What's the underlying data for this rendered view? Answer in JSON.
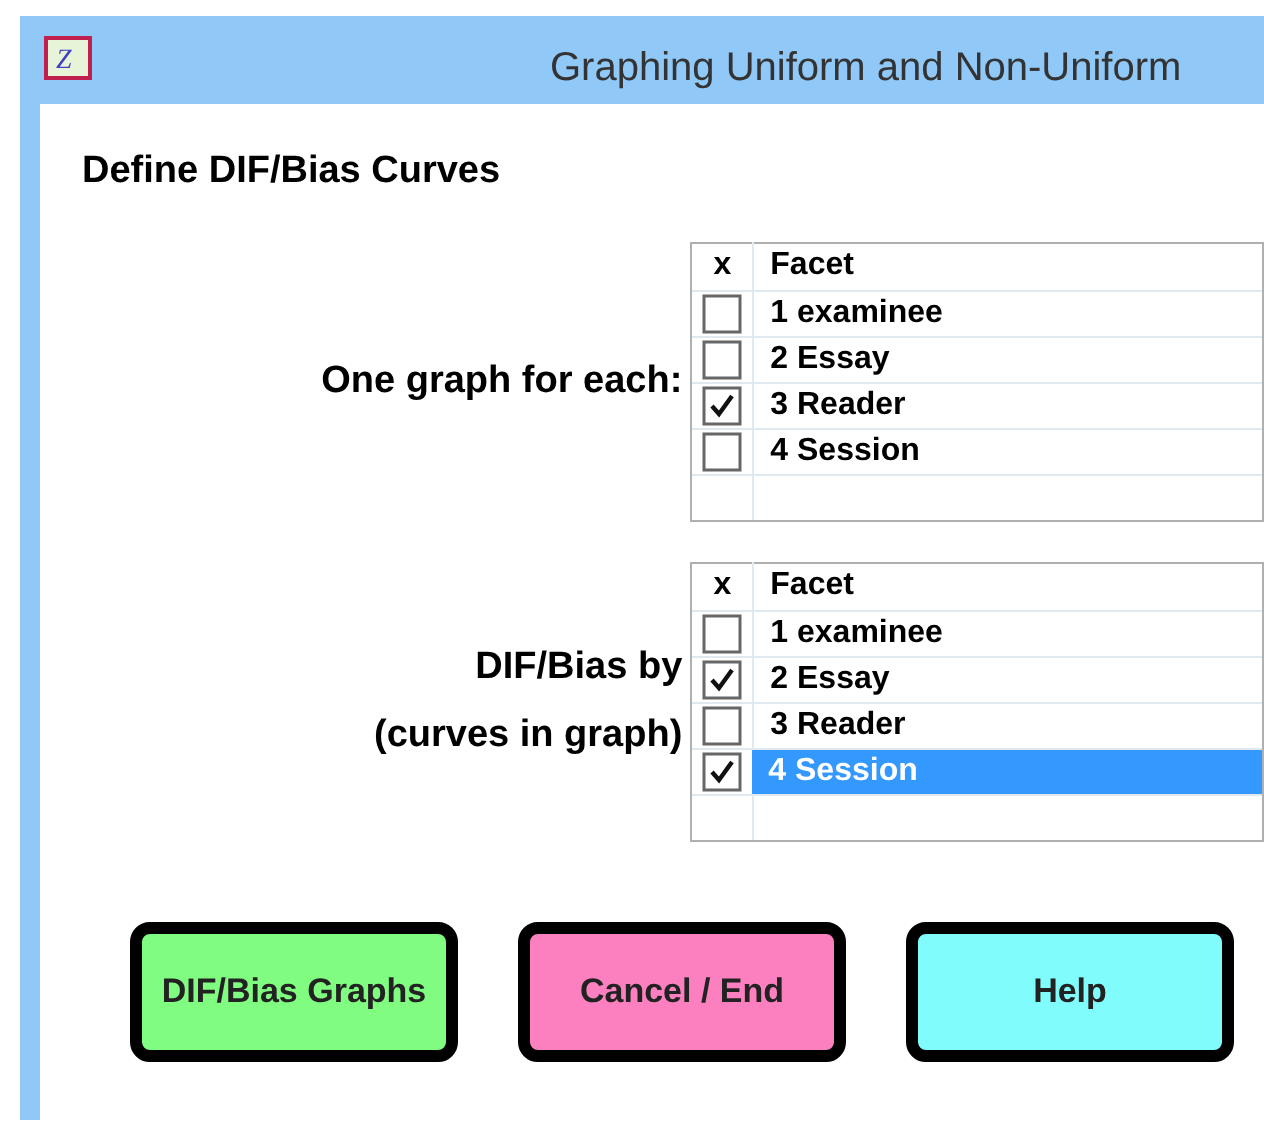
{
  "window": {
    "icon_letter": "Z",
    "title": "Graphing Uniform and Non-Uniform"
  },
  "heading": "Define DIF/Bias Curves",
  "groups": [
    {
      "label_lines": [
        "One graph for each:"
      ],
      "columns": [
        "x",
        "Facet"
      ],
      "rows": [
        {
          "label": "1 examinee",
          "checked": false,
          "selected": false
        },
        {
          "label": "2 Essay",
          "checked": false,
          "selected": false
        },
        {
          "label": "3 Reader",
          "checked": true,
          "selected": false
        },
        {
          "label": "4 Session",
          "checked": false,
          "selected": false
        }
      ]
    },
    {
      "label_lines": [
        "DIF/Bias by",
        "(curves in graph)"
      ],
      "columns": [
        "x",
        "Facet"
      ],
      "rows": [
        {
          "label": "1 examinee",
          "checked": false,
          "selected": false
        },
        {
          "label": "2 Essay",
          "checked": true,
          "selected": false
        },
        {
          "label": "3 Reader",
          "checked": false,
          "selected": false
        },
        {
          "label": "4 Session",
          "checked": true,
          "selected": true
        }
      ]
    }
  ],
  "buttons": [
    {
      "label": "DIF/Bias Graphs",
      "color": "#80fc80"
    },
    {
      "label": "Cancel / End",
      "color": "#fc80c0"
    },
    {
      "label": "Help",
      "color": "#80fcfc"
    }
  ]
}
